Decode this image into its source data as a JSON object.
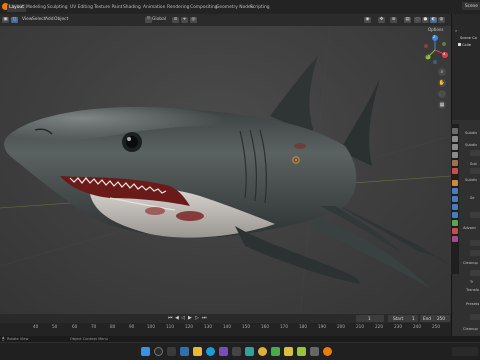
{
  "workspace_tabs": [
    "Layout",
    "Modeling",
    "Sculpting",
    "UV Editing",
    "Texture Paint",
    "Shading",
    "Animation",
    "Rendering",
    "Compositing",
    "Geometry Nodes",
    "Scripting"
  ],
  "top_right": {
    "scene_label": "Scene"
  },
  "viewport_header": {
    "menus": [
      "View",
      "Select",
      "Add",
      "Object"
    ],
    "transform_orientation": "Global"
  },
  "gizmo": {
    "axes": [
      "X",
      "Y",
      "Z"
    ]
  },
  "options_label": "Options",
  "outliner": {
    "items": [
      "Scene Co",
      "Colle"
    ]
  },
  "properties_labels": [
    "Subdiv",
    "Subdiv",
    "Sub",
    "Subdiv",
    "Se",
    "Advanc",
    "Cleanup",
    "Tr",
    "Transfo",
    "Presets",
    "Cleanup"
  ],
  "playback": {
    "start_label": "Start",
    "start_value": "1",
    "end_label": "End",
    "end_value": "250",
    "current_frame": "1"
  },
  "timeline_ticks": [
    "40",
    "50",
    "60",
    "70",
    "80",
    "90",
    "100",
    "110",
    "120",
    "130",
    "140",
    "150",
    "160",
    "170",
    "180",
    "190",
    "200",
    "210",
    "220",
    "230",
    "240",
    "250"
  ],
  "status_bar": {
    "left": "Rotate View",
    "right": "Object Context Menu"
  },
  "colors": {
    "accent": "#4b6a8f",
    "axis_x": "#e0404e",
    "axis_y": "#8ac03a",
    "axis_z": "#3f86d4"
  }
}
